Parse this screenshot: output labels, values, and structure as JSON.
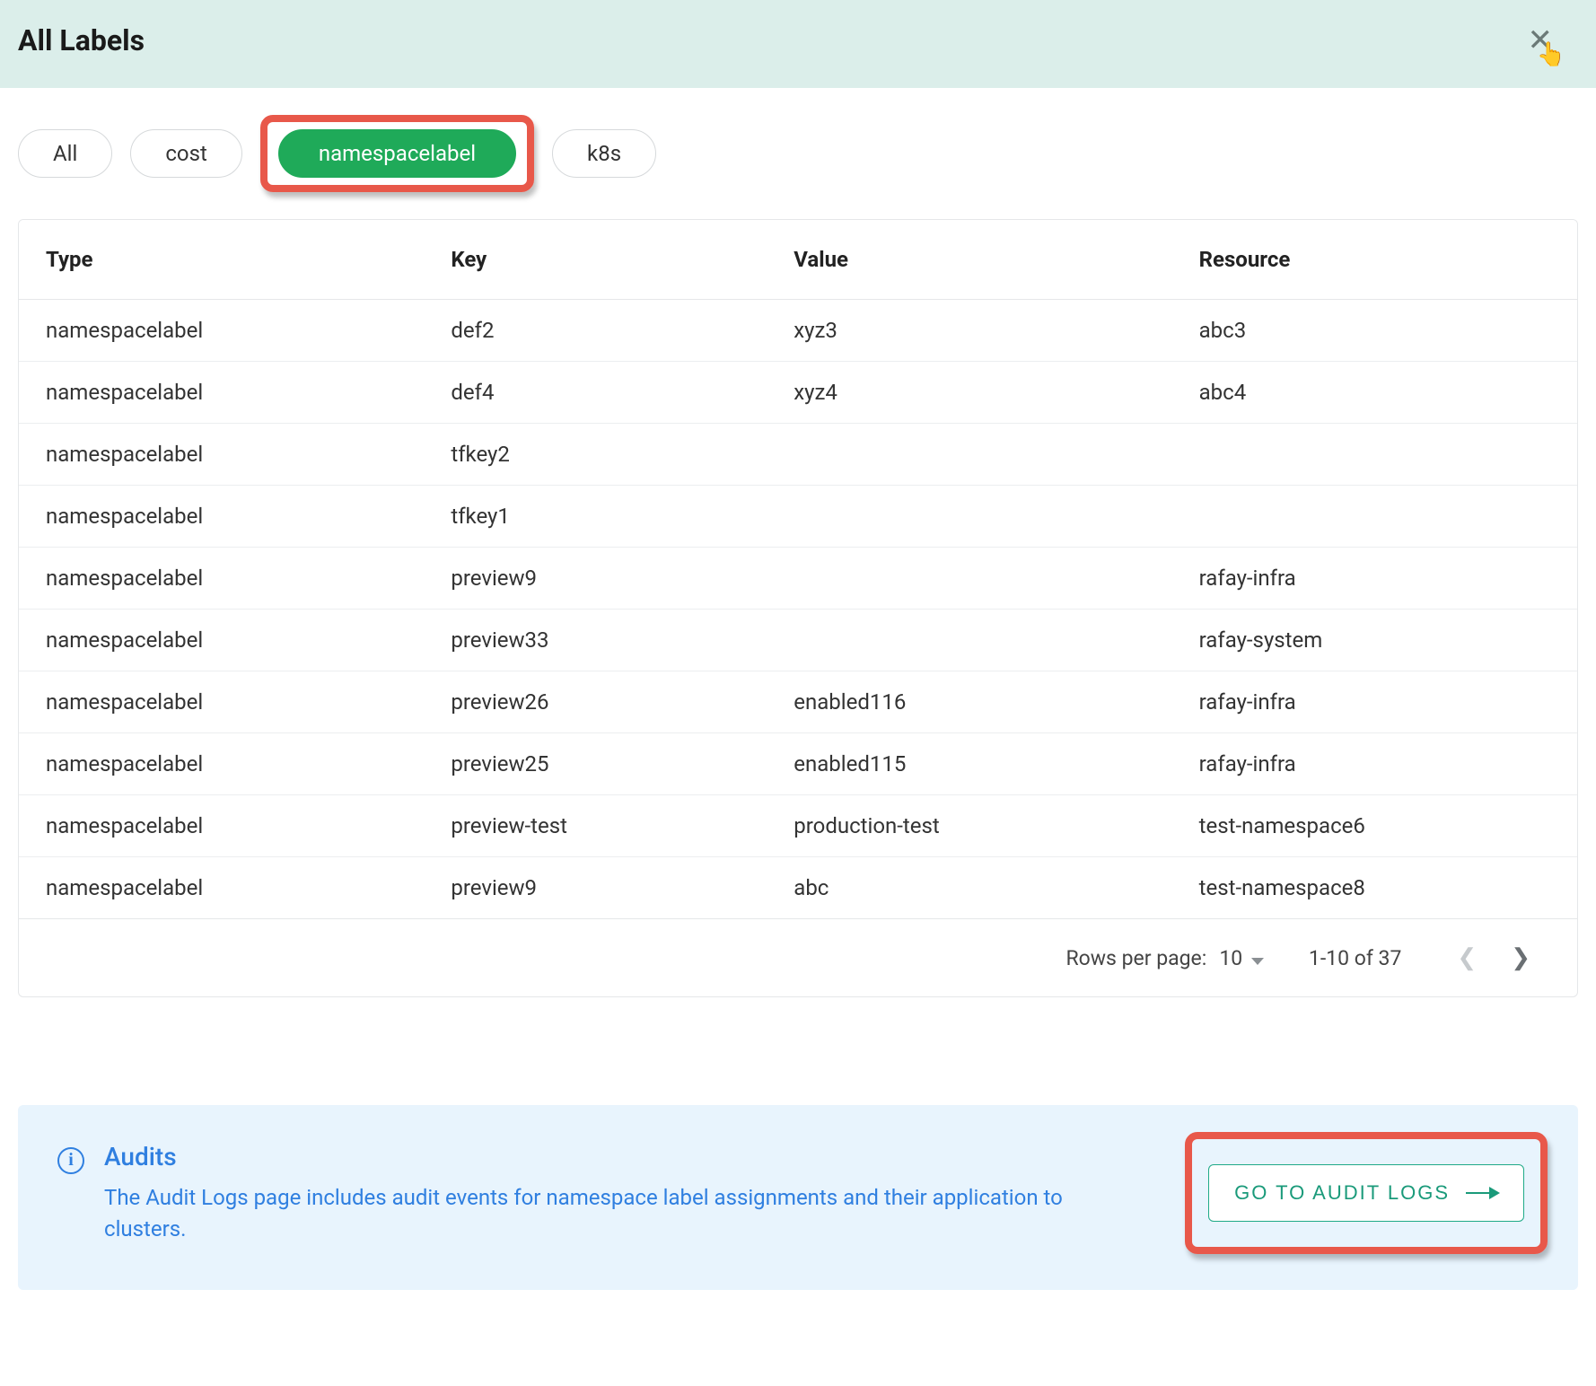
{
  "header": {
    "title": "All Labels"
  },
  "chips": [
    {
      "label": "All",
      "active": false
    },
    {
      "label": "cost",
      "active": false
    },
    {
      "label": "namespacelabel",
      "active": true
    },
    {
      "label": "k8s",
      "active": false
    }
  ],
  "table": {
    "columns": [
      "Type",
      "Key",
      "Value",
      "Resource"
    ],
    "rows": [
      {
        "type": "namespacelabel",
        "key": "def2",
        "value": "xyz3",
        "resource": "abc3"
      },
      {
        "type": "namespacelabel",
        "key": "def4",
        "value": "xyz4",
        "resource": "abc4"
      },
      {
        "type": "namespacelabel",
        "key": "tfkey2",
        "value": "",
        "resource": ""
      },
      {
        "type": "namespacelabel",
        "key": "tfkey1",
        "value": "",
        "resource": ""
      },
      {
        "type": "namespacelabel",
        "key": "preview9",
        "value": "",
        "resource": "rafay-infra"
      },
      {
        "type": "namespacelabel",
        "key": "preview33",
        "value": "",
        "resource": "rafay-system"
      },
      {
        "type": "namespacelabel",
        "key": "preview26",
        "value": "enabled116",
        "resource": "rafay-infra"
      },
      {
        "type": "namespacelabel",
        "key": "preview25",
        "value": "enabled115",
        "resource": "rafay-infra"
      },
      {
        "type": "namespacelabel",
        "key": "preview-test",
        "value": "production-test",
        "resource": "test-namespace6"
      },
      {
        "type": "namespacelabel",
        "key": "preview9",
        "value": "abc",
        "resource": "test-namespace8"
      }
    ]
  },
  "pagination": {
    "rows_label": "Rows per page:",
    "rows_value": "10",
    "range": "1-10 of 37"
  },
  "audits": {
    "title": "Audits",
    "desc": "The Audit Logs page includes audit events for namespace label assignments and their application to clusters.",
    "button": "GO TO AUDIT LOGS"
  }
}
